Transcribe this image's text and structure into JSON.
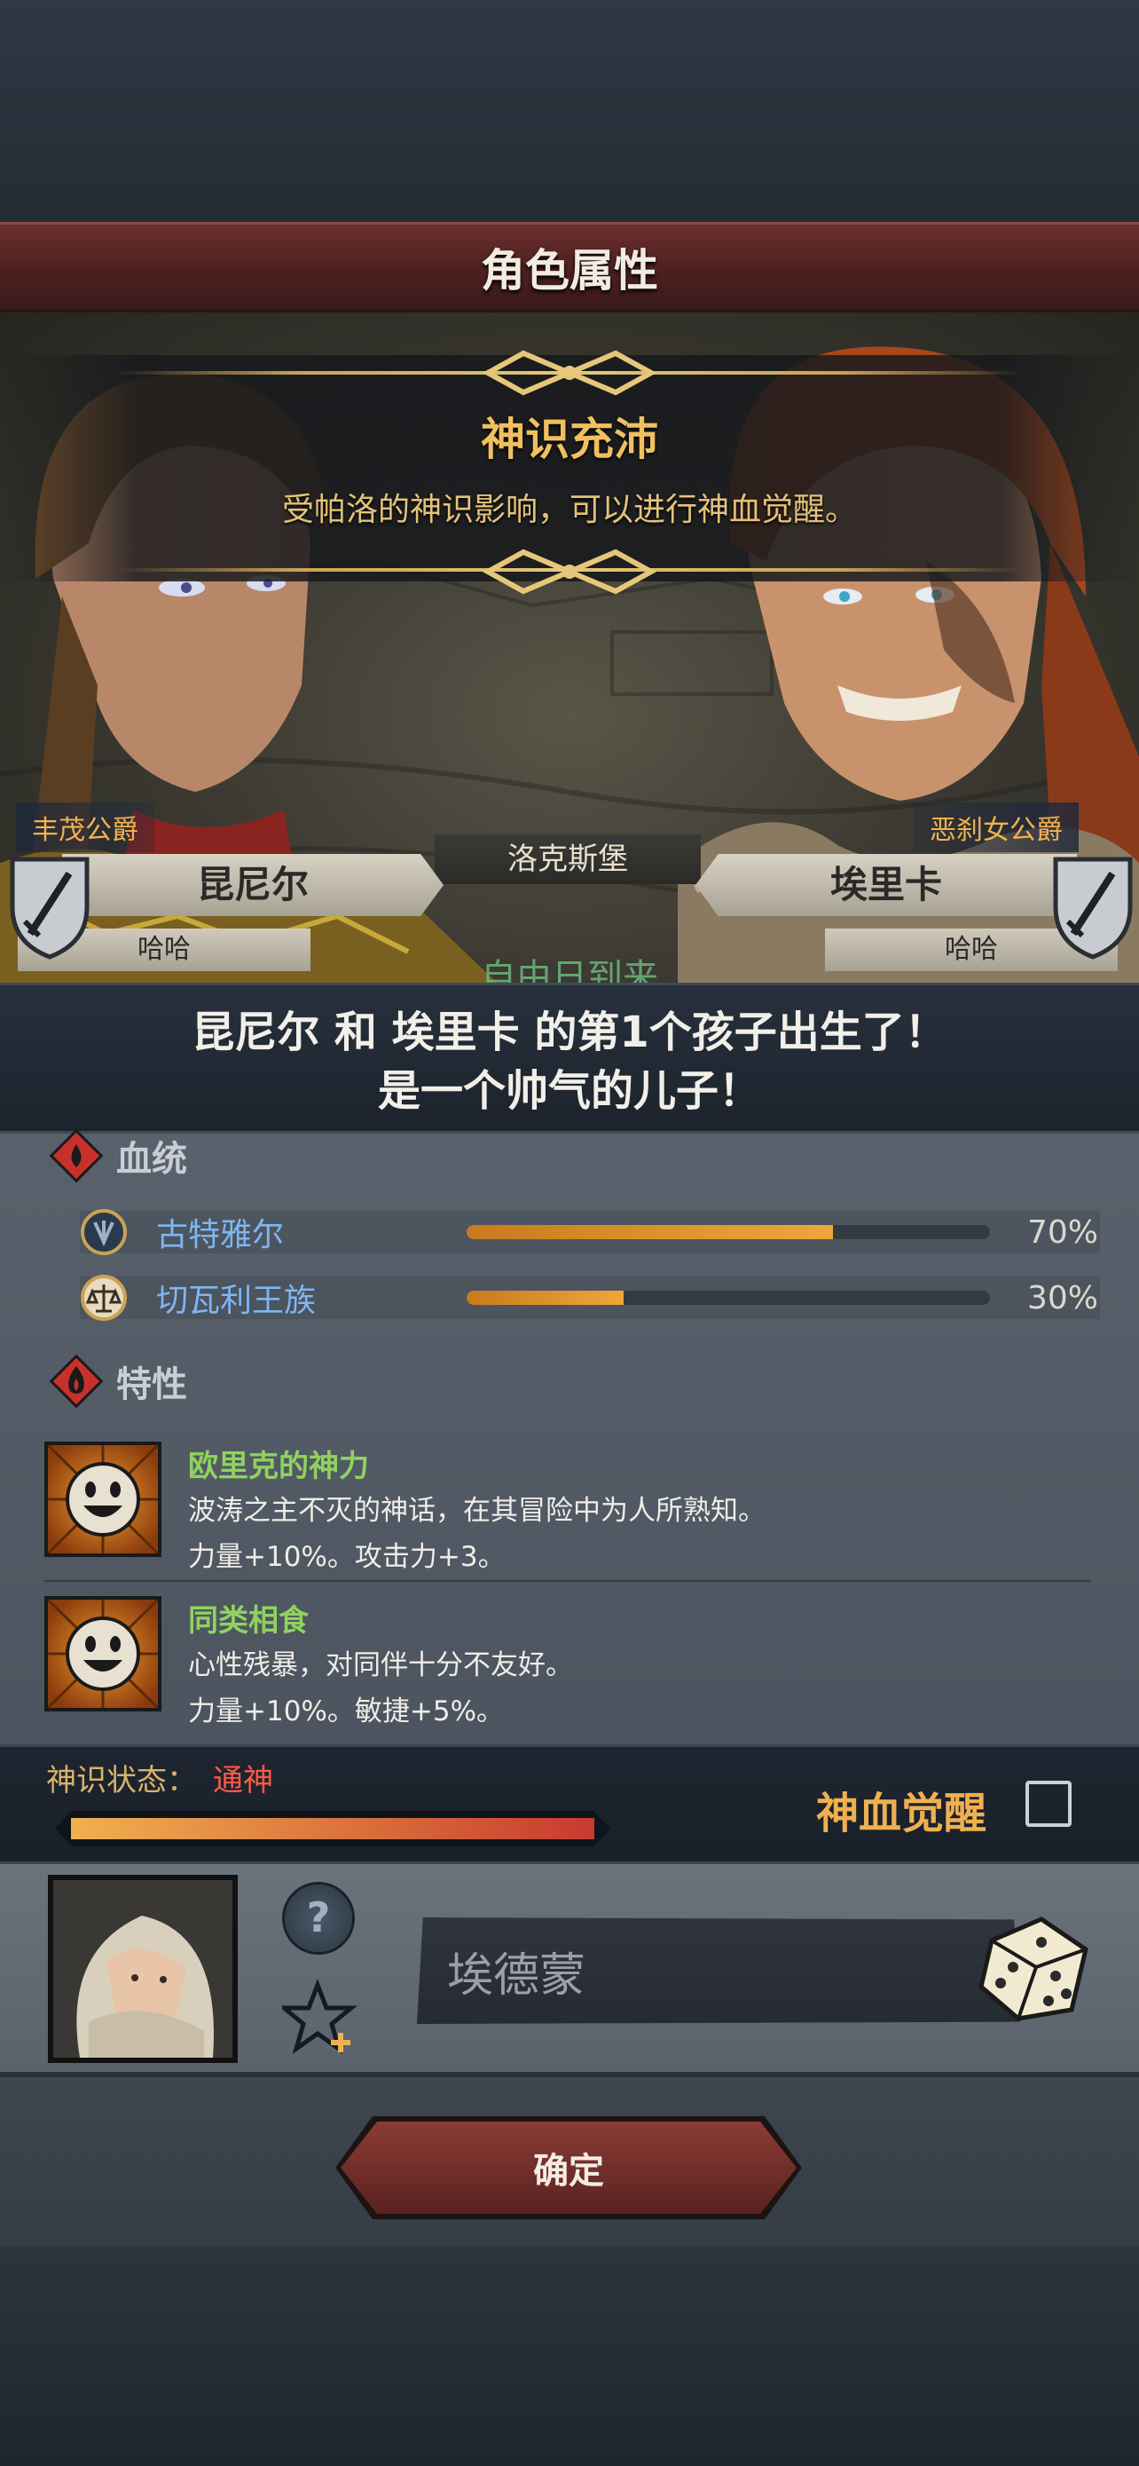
{
  "header": {
    "title": "角色属性"
  },
  "banner": {
    "title": "神识充沛",
    "subtitle": "受帕洛的神识影响，可以进行神血觉醒。",
    "event_text": "自由日到来"
  },
  "location": "洛克斯堡",
  "parents": {
    "father": {
      "title": "丰茂公爵",
      "name": "昆尼尔",
      "sub": "哈哈"
    },
    "mother": {
      "title": "恶刹女公爵",
      "name": "埃里卡",
      "sub": "哈哈"
    }
  },
  "announcement": {
    "line1": "昆尼尔 和 埃里卡 的第1个孩子出生了！",
    "line2": "是一个帅气的儿子！"
  },
  "bloodline": {
    "header": "血统",
    "items": [
      {
        "name": "古特雅尔",
        "percent_value": 0.7,
        "percent": "70%"
      },
      {
        "name": "切瓦利王族",
        "percent_value": 0.3,
        "percent": "30%"
      }
    ]
  },
  "traits": {
    "header": "特性",
    "items": [
      {
        "name": "欧里克的神力",
        "desc": "波涛之主不灭的神话，在其冒险中为人所熟知。",
        "effect": "力量+10%。攻击力+3。"
      },
      {
        "name": "同类相食",
        "desc": "心性残暴，对同伴十分不友好。",
        "effect": "力量+10%。敏捷+5%。"
      }
    ]
  },
  "divine_status": {
    "label": "神识状态：",
    "value": "通神",
    "level": 1.0,
    "awaken_label": "神血觉醒",
    "awaken_checked": false
  },
  "child": {
    "help_label": "?",
    "name_value": "埃德蒙"
  },
  "confirm_label": "确定",
  "colors": {
    "accent_gold": "#f0b050",
    "bloodline_name": "#7fb6f2",
    "trait_name": "#8fd35c",
    "status_value": "#ff5a45",
    "title_red": "#6b2e2c"
  }
}
